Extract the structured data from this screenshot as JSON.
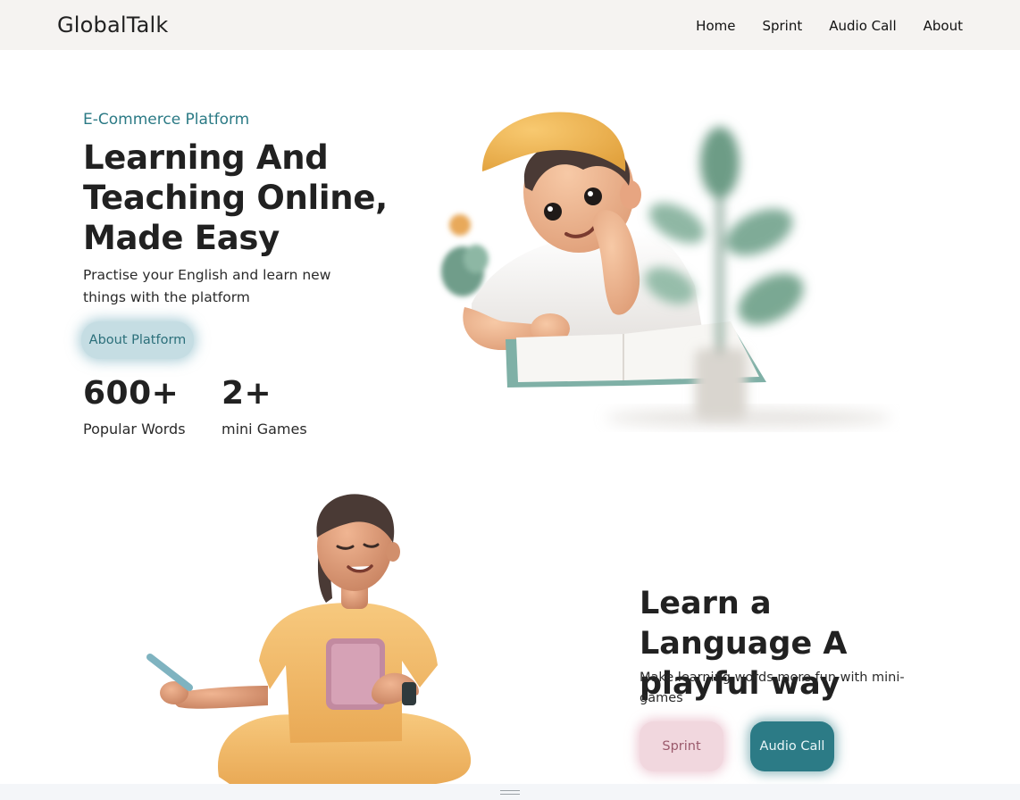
{
  "header": {
    "brand": "GlobalTalk",
    "nav": [
      "Home",
      "Sprint",
      "Audio Call",
      "About"
    ]
  },
  "hero": {
    "eyebrow": "E-Commerce Platform",
    "title": "Learning And Teaching Online, Made Easy",
    "subtitle": "Practise your English and learn new things with the platform",
    "cta": "About Platform",
    "stats": [
      {
        "value": "600+",
        "label": "Popular Words"
      },
      {
        "value": "2+",
        "label": "mini Games"
      }
    ]
  },
  "learn": {
    "title": "Learn a Language A playful way",
    "subtitle": "Make learning words more fun with mini-games",
    "buttons": {
      "sprint": "Sprint",
      "audio": "Audio Call"
    }
  },
  "colors": {
    "accent": "#2b7a85",
    "header_bg": "#f5f3f1",
    "about_btn_bg": "#c5dde3",
    "sprint_btn_bg": "#f1d7de",
    "audio_btn_bg": "#2c7b86"
  }
}
